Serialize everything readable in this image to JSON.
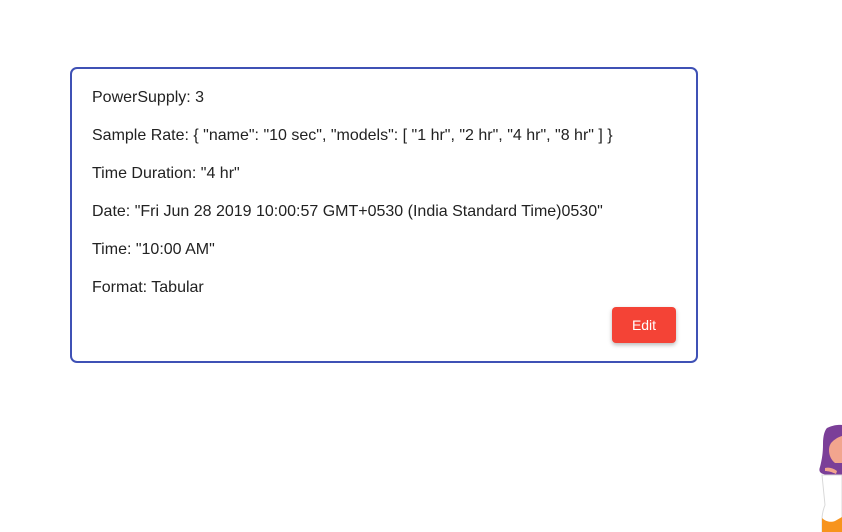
{
  "card": {
    "power_supply": "PowerSupply: 3",
    "sample_rate": "Sample Rate: { \"name\": \"10 sec\", \"models\": [ \"1 hr\", \"2 hr\", \"4 hr\", \"8 hr\" ] }",
    "time_duration": "Time Duration: \"4 hr\"",
    "date": "Date: \"Fri Jun 28 2019 10:00:57 GMT+0530 (India Standard Time)0530\"",
    "time": "Time: \"10:00 AM\"",
    "format": "Format: Tabular",
    "edit_label": "Edit"
  },
  "colors": {
    "card_border": "#3f51b5",
    "edit_button": "#f44336",
    "figure_hair": "#7b3f98",
    "figure_skin": "#f2a58e",
    "figure_clothes": "#f7941d"
  },
  "icons": {
    "corner_figure": "assistant-character-illustration"
  }
}
